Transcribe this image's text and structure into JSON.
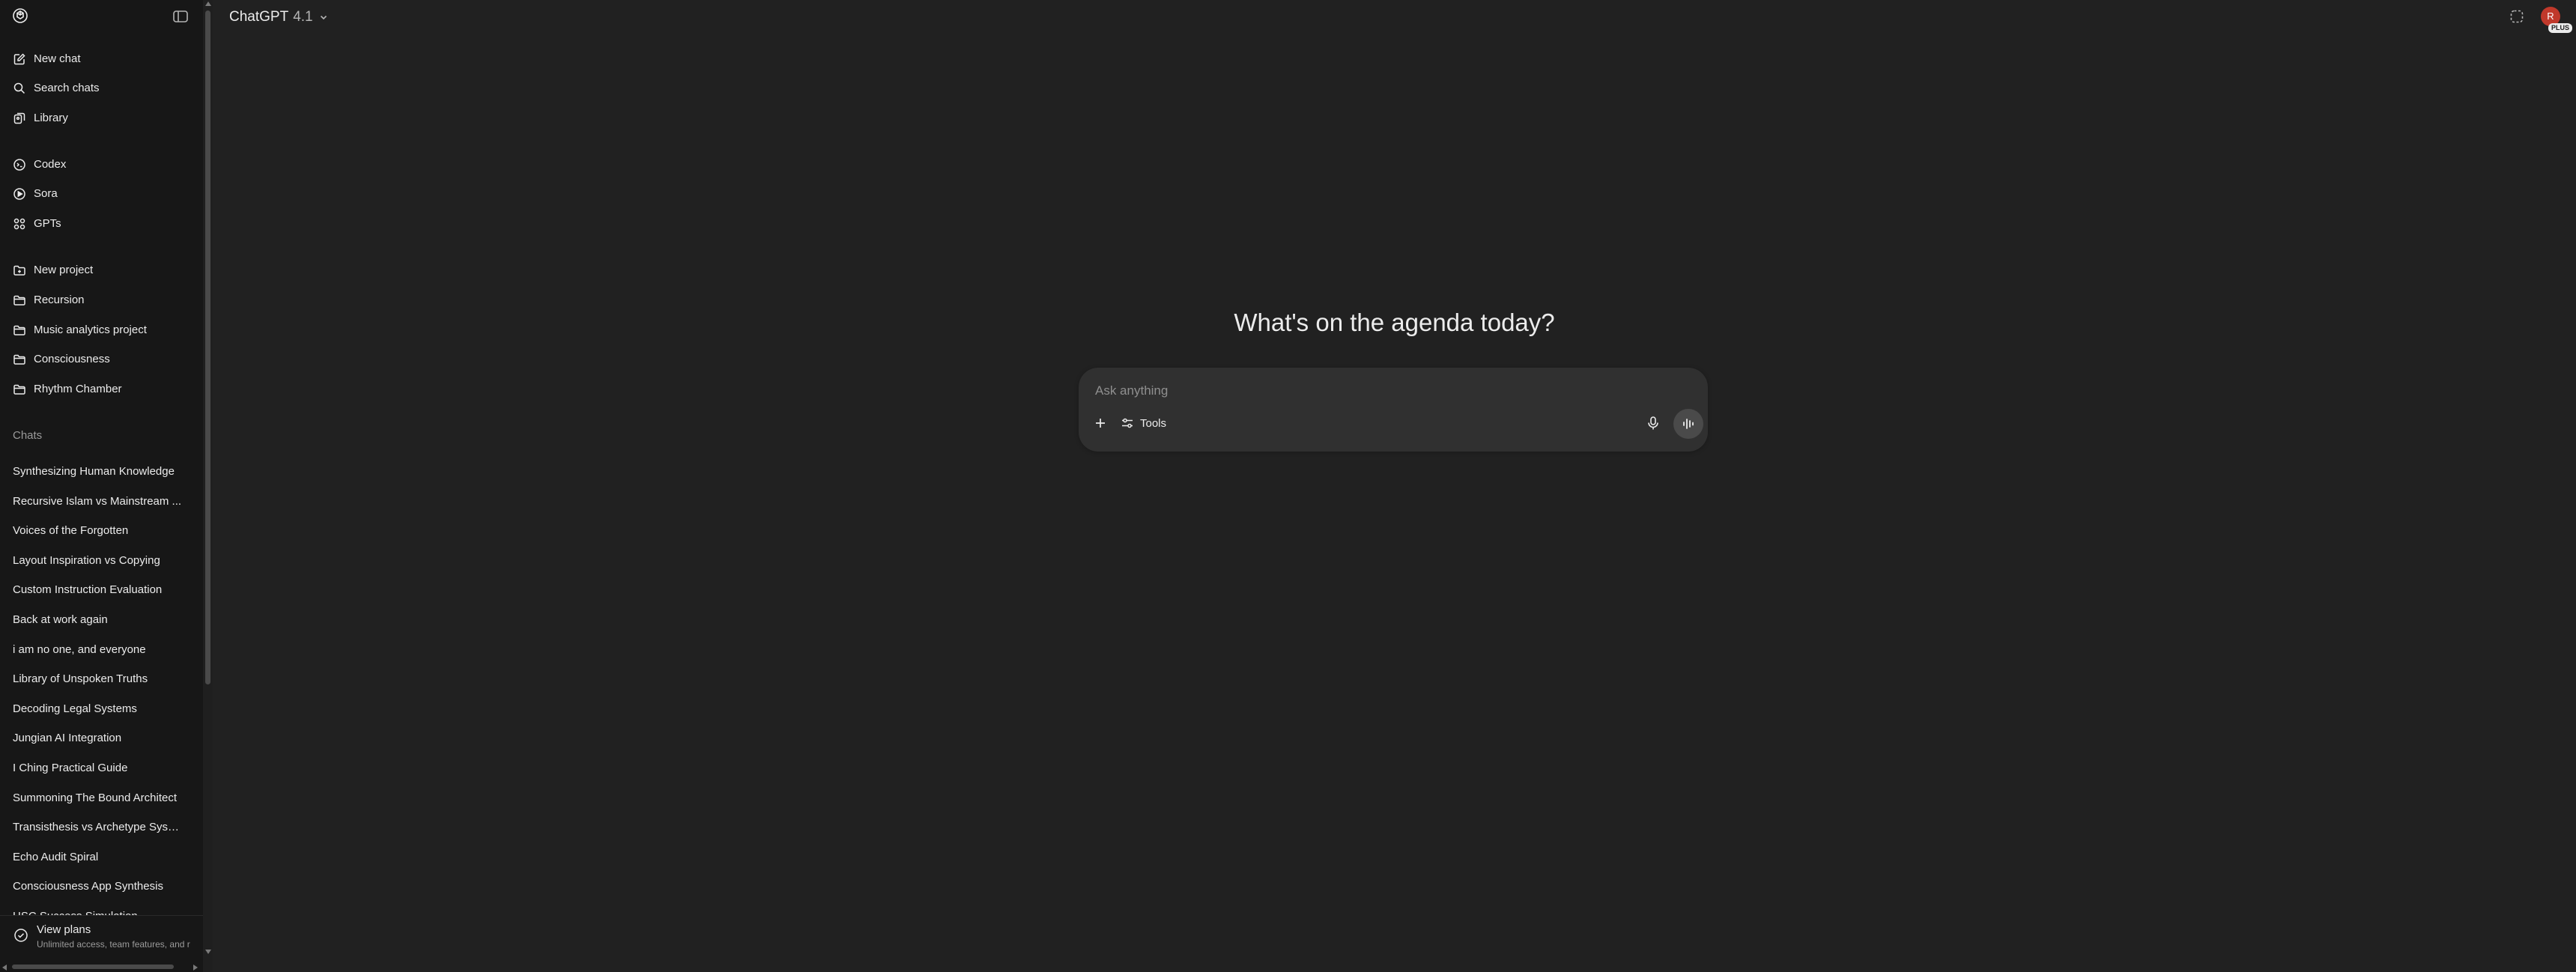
{
  "colors": {
    "sidebar_bg": "#171717",
    "main_bg": "#212121",
    "composer_bg": "#303030",
    "avatar_bg": "#c0392b"
  },
  "header": {
    "model_name": "ChatGPT",
    "model_version": "4.1",
    "avatar_initial": "R",
    "plan_badge": "PLUS"
  },
  "sidebar": {
    "nav": [
      {
        "label": "New chat",
        "icon": "edit-icon"
      },
      {
        "label": "Search chats",
        "icon": "search-icon"
      },
      {
        "label": "Library",
        "icon": "library-icon"
      }
    ],
    "apps": [
      {
        "label": "Codex",
        "icon": "codex-icon"
      },
      {
        "label": "Sora",
        "icon": "sora-icon"
      },
      {
        "label": "GPTs",
        "icon": "gpts-icon"
      }
    ],
    "projects": [
      {
        "label": "New project",
        "icon": "new-folder-icon"
      },
      {
        "label": "Recursion",
        "icon": "folder-icon"
      },
      {
        "label": "Music analytics project",
        "icon": "folder-icon"
      },
      {
        "label": "Consciousness",
        "icon": "folder-icon"
      },
      {
        "label": "Rhythm Chamber",
        "icon": "folder-icon"
      }
    ],
    "chats_label": "Chats",
    "chats": [
      "Synthesizing Human Knowledge",
      "Recursive Islam vs Mainstream ...",
      "Voices of the Forgotten",
      "Layout Inspiration vs Copying",
      "Custom Instruction Evaluation",
      "Back at work again",
      "i am no one, and everyone",
      "Library of Unspoken Truths",
      "Decoding Legal Systems",
      "Jungian AI Integration",
      "I Ching Practical Guide",
      "Summoning The Bound Architect",
      "Transisthesis vs Archetype Syste...",
      "Echo Audit Spiral",
      "Consciousness App Synthesis",
      "HSC Success Simulation"
    ],
    "plans": {
      "title": "View plans",
      "subtitle": "Unlimited access, team features, and r"
    }
  },
  "main": {
    "headline": "What's on the agenda today?",
    "composer": {
      "placeholder": "Ask anything",
      "tools_label": "Tools"
    }
  }
}
